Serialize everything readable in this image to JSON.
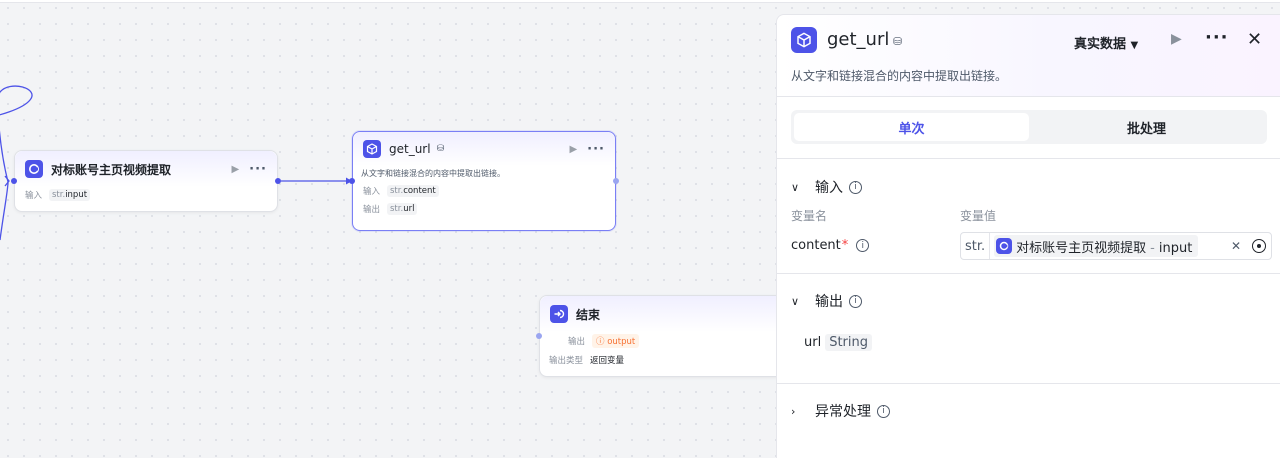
{
  "nodes": {
    "source": {
      "title": "对标账号主页视频提取",
      "input_label": "输入",
      "input_type_prefix": "str.",
      "input_value": "input",
      "play_icon": "play-icon",
      "more_icon": "more-icon"
    },
    "get_url": {
      "title": "get_url",
      "badge_icon": "plugin-badge-icon",
      "description": "从文字和链接混合的内容中提取出链接。",
      "input_label": "输入",
      "input_type_prefix": "str.",
      "input_value": "content",
      "output_label": "输出",
      "output_type_prefix": "str.",
      "output_value": "url"
    },
    "end": {
      "title": "结束",
      "output_label": "输出",
      "output_value": "output",
      "output_type_label": "输出类型",
      "output_type_value": "返回变量"
    }
  },
  "panel": {
    "title": "get_url",
    "description": "从文字和链接混合的内容中提取出链接。",
    "data_mode": "真实数据",
    "tabs": [
      {
        "label": "单次",
        "active": true
      },
      {
        "label": "批处理",
        "active": false
      }
    ],
    "input_section": {
      "title": "输入",
      "col_name": "变量名",
      "col_value": "变量值",
      "param_name": "content",
      "required_mark": "*",
      "ref_type": "str.",
      "ref_node": "对标账号主页视频提取",
      "ref_sep": "-",
      "ref_var": "input"
    },
    "output_section": {
      "title": "输出",
      "var_name": "url",
      "var_type": "String"
    },
    "exception_section": {
      "title": "异常处理"
    }
  },
  "colors": {
    "accent": "#4d53e8",
    "warning": "#f77234",
    "required": "#f53f3f"
  }
}
